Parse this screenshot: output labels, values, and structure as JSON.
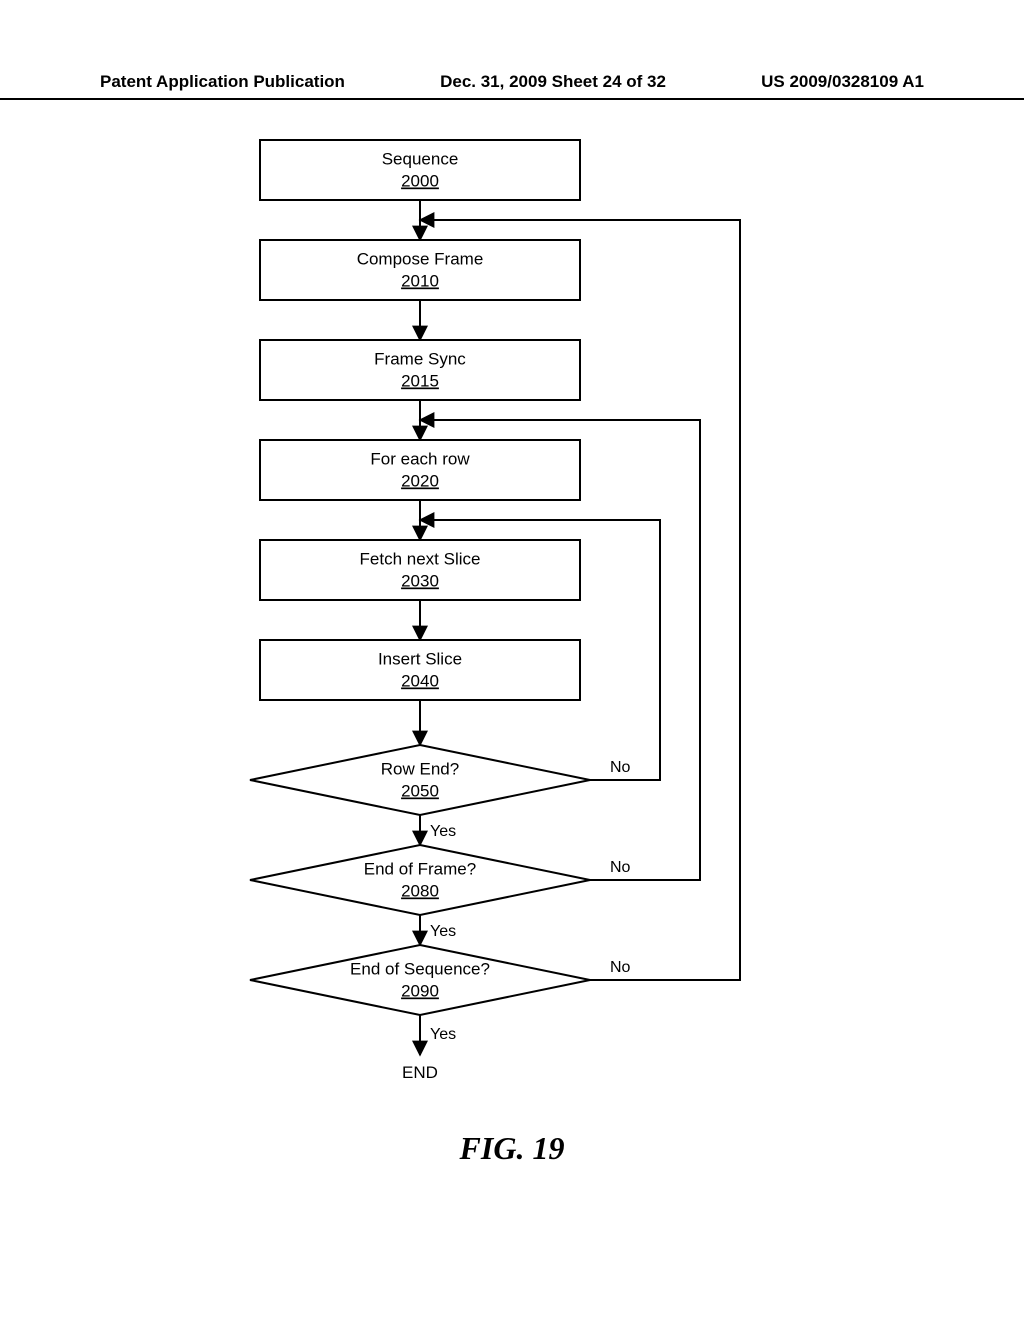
{
  "header": {
    "left": "Patent Application Publication",
    "mid": "Dec. 31, 2009  Sheet 24 of 32",
    "right": "US 2009/0328109 A1"
  },
  "figure_label": "FIG. 19",
  "nodes": {
    "n0_label": "Sequence",
    "n0_num": "2000",
    "n1_label": "Compose Frame",
    "n1_num": "2010",
    "n2_label": "Frame Sync",
    "n2_num": "2015",
    "n3_label": "For each row",
    "n3_num": "2020",
    "n4_label": "Fetch next Slice",
    "n4_num": "2030",
    "n5_label": "Insert Slice",
    "n5_num": "2040",
    "d0_label": "Row End?",
    "d0_num": "2050",
    "d1_label": "End of Frame?",
    "d1_num": "2080",
    "d2_label": "End of Sequence?",
    "d2_num": "2090"
  },
  "labels": {
    "yes": "Yes",
    "no": "No",
    "end": "END"
  }
}
